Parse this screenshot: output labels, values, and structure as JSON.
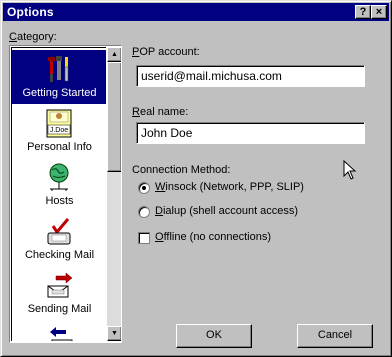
{
  "window": {
    "title": "Options",
    "help_label": "?",
    "close_label": "×"
  },
  "category": {
    "label": "Category:",
    "items": [
      {
        "label": "Getting Started",
        "icon": "tools-icon",
        "selected": true
      },
      {
        "label": "Personal Info",
        "icon": "id-card-icon",
        "badge": "J.Doe"
      },
      {
        "label": "Hosts",
        "icon": "globe-network-icon"
      },
      {
        "label": "Checking Mail",
        "icon": "mailbox-check-icon"
      },
      {
        "label": "Sending Mail",
        "icon": "send-mail-icon"
      }
    ]
  },
  "pop": {
    "label": "POP account:",
    "value": "userid@mail.michusa.com"
  },
  "realname": {
    "label": "Real name:",
    "value": "John Doe"
  },
  "connection": {
    "label": "Connection Method:",
    "options": [
      {
        "label": "Winsock (Network, PPP, SLIP)",
        "selected": true
      },
      {
        "label": "Dialup (shell account access)",
        "selected": false
      }
    ],
    "offline": {
      "label": "Offline (no connections)",
      "checked": false
    }
  },
  "buttons": {
    "ok": "OK",
    "cancel": "Cancel"
  }
}
